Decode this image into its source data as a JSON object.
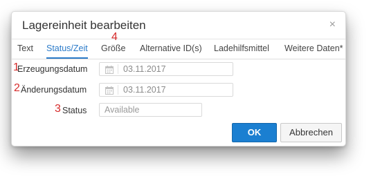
{
  "dialog": {
    "title": "Lagereinheit bearbeiten",
    "close_glyph": "×"
  },
  "tabs": [
    {
      "label": "Text",
      "active": false
    },
    {
      "label": "Status/Zeit",
      "active": true
    },
    {
      "label": "Größe",
      "active": false
    },
    {
      "label": "Alternative ID(s)",
      "active": false
    },
    {
      "label": "Ladehilfsmittel",
      "active": false
    },
    {
      "label": "Weitere Daten*",
      "active": false
    }
  ],
  "markers": [
    "1",
    "2",
    "3",
    "4"
  ],
  "form": {
    "creation_date": {
      "label": "Erzeugungsdatum",
      "value": "03.11.2017",
      "icon": "calendar-icon"
    },
    "change_date": {
      "label": "Änderungsdatum",
      "value": "03.11.2017",
      "icon": "calendar-icon"
    },
    "status": {
      "label": "Status",
      "placeholder": "Available"
    }
  },
  "buttons": {
    "ok": "OK",
    "cancel": "Abbrechen"
  },
  "colors": {
    "accent": "#2a7ac9",
    "primary_button": "#1b7fd1",
    "marker": "#d62a2a"
  }
}
